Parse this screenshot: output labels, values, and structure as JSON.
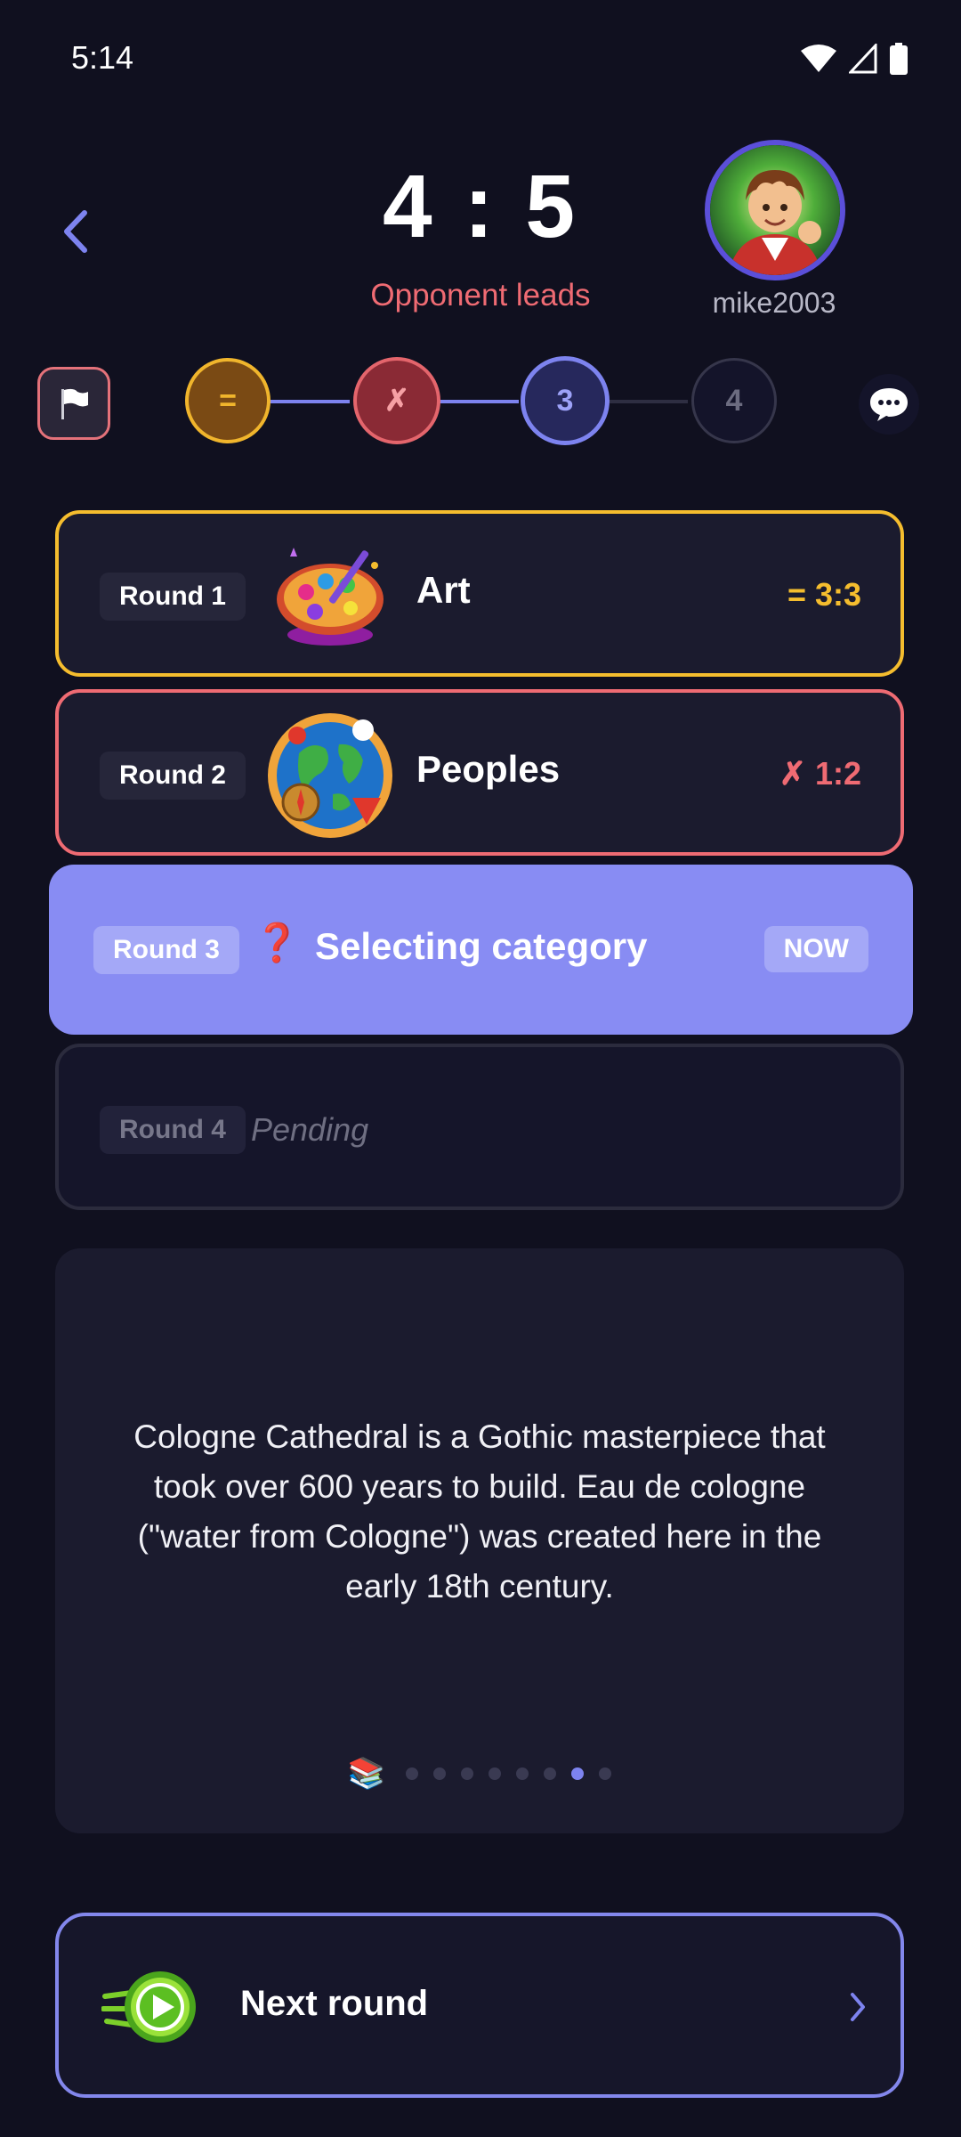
{
  "status_bar": {
    "time": "5:14"
  },
  "header": {
    "score": "4 : 5",
    "lead_text": "Opponent leads",
    "opponent": {
      "username": "mike2003"
    }
  },
  "progress": {
    "nodes": [
      {
        "label": "=",
        "state": "draw",
        "color": "#f0b52c"
      },
      {
        "label": "✗",
        "state": "lost",
        "color": "#e4656c"
      },
      {
        "label": "3",
        "state": "current",
        "color": "#7d83ef"
      },
      {
        "label": "4",
        "state": "pending",
        "color": "#36364b"
      }
    ]
  },
  "rounds": [
    {
      "tag": "Round 1",
      "category": "Art",
      "result": "= 3:3",
      "color": "#f5bd2e"
    },
    {
      "tag": "Round 2",
      "category": "Peoples",
      "result": "✗ 1:2",
      "color": "#ef6b73"
    },
    {
      "tag": "Round 3",
      "icon": "❓",
      "status": "Selecting category",
      "badge": "NOW",
      "color": "#888cf3"
    },
    {
      "tag": "Round 4",
      "status": "Pending"
    }
  ],
  "fact": {
    "text": "Cologne Cathedral is a Gothic masterpiece that took over 600 years to build. Eau de cologne (\"water from Cologne\") was created here in the early 18th century.",
    "icon": "📚",
    "page_count": 8,
    "active_page": 7
  },
  "next_button": {
    "label": "Next round"
  }
}
